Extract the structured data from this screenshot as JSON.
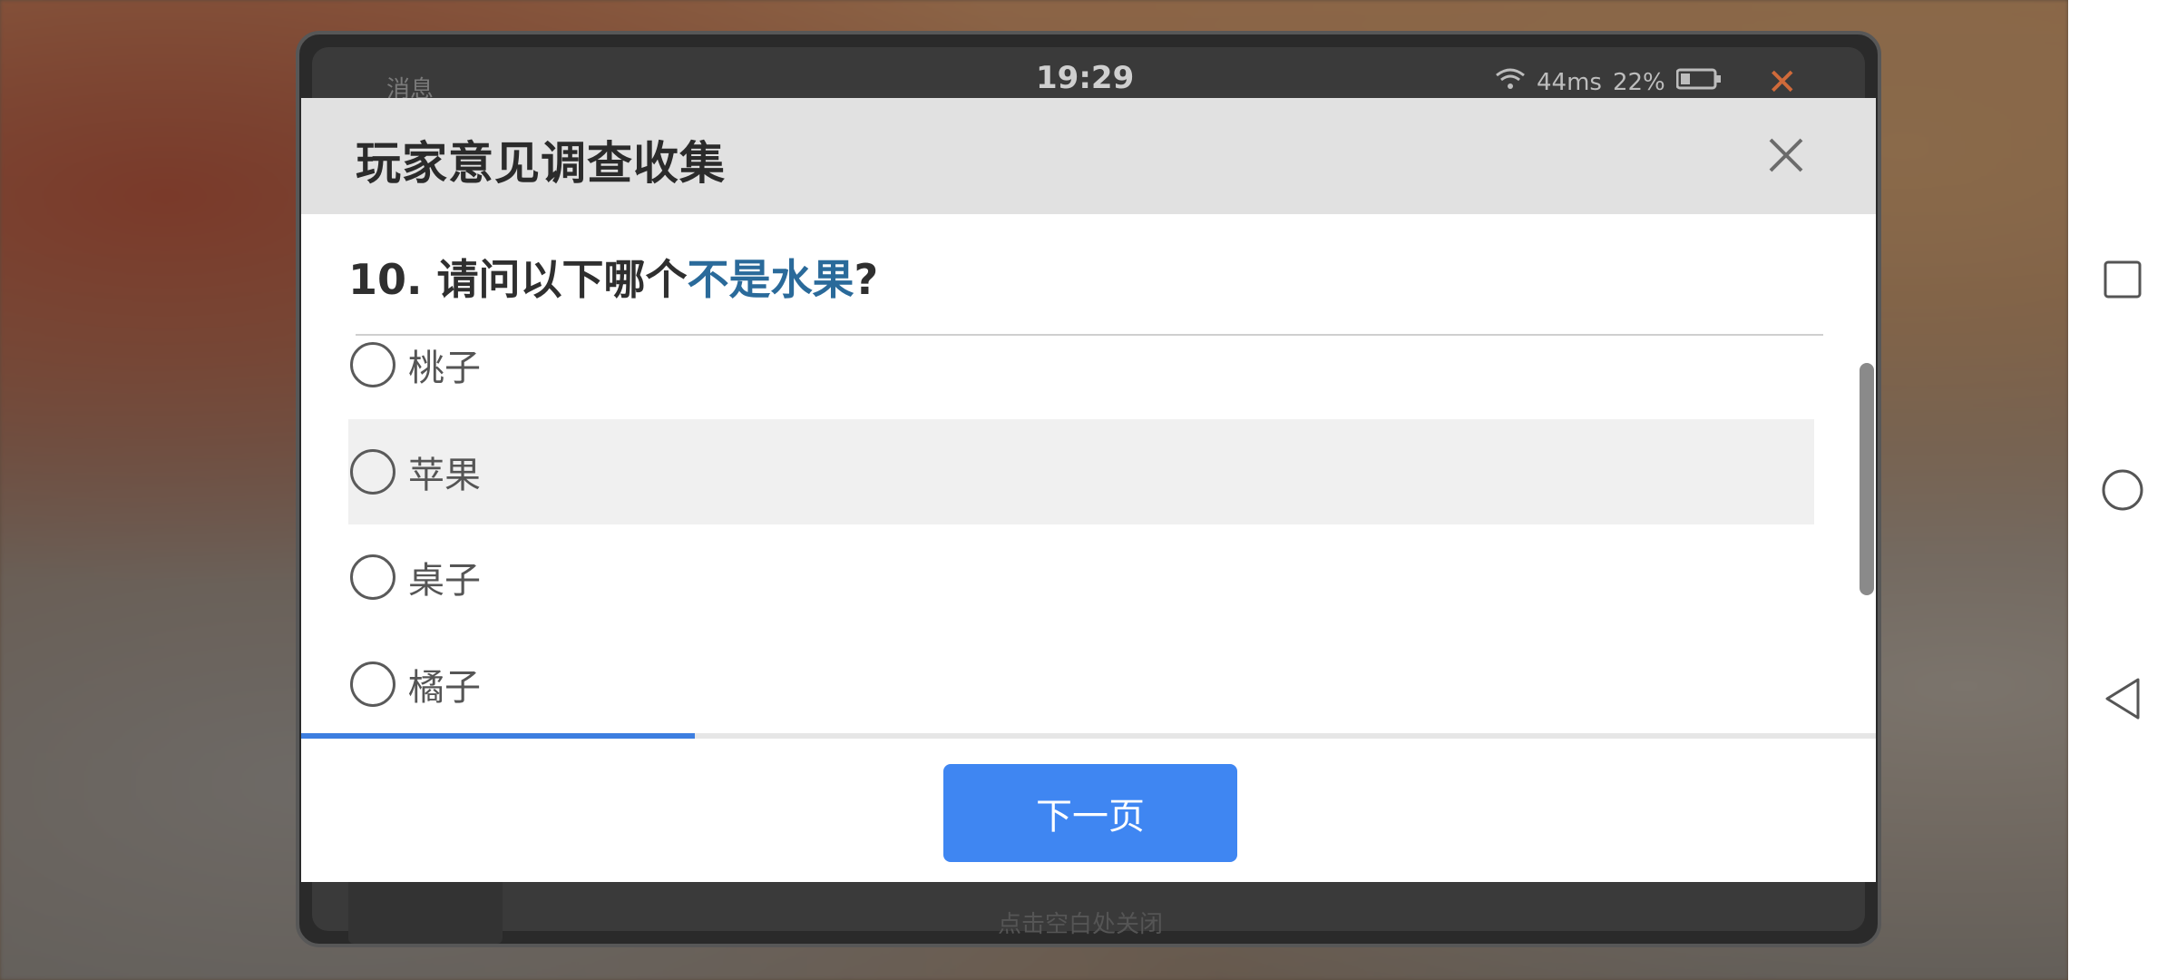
{
  "device": {
    "status_left": "消息",
    "time": "19:29",
    "signal": "44ms",
    "battery": "22%",
    "bottom_hint": "点击空白处关闭"
  },
  "dialog": {
    "title": "玩家意见调查收集",
    "question_prefix": "10. 请问以下哪个",
    "question_highlight": "不是水果",
    "question_suffix": "?",
    "options": [
      {
        "label": "桃子",
        "hovered": false
      },
      {
        "label": "苹果",
        "hovered": true
      },
      {
        "label": "桌子",
        "hovered": false
      },
      {
        "label": "橘子",
        "hovered": false
      }
    ],
    "progress_fraction": 0.25,
    "next_label": "下一页"
  },
  "colors": {
    "accent": "#3f86f2",
    "highlight": "#2a6a9a",
    "header_bg": "#e1e1e1"
  }
}
